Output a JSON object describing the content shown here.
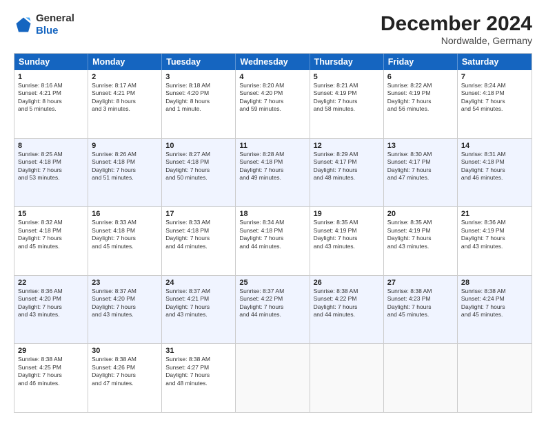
{
  "header": {
    "logo_line1": "General",
    "logo_line2": "Blue",
    "month_title": "December 2024",
    "location": "Nordwalde, Germany"
  },
  "weekdays": [
    "Sunday",
    "Monday",
    "Tuesday",
    "Wednesday",
    "Thursday",
    "Friday",
    "Saturday"
  ],
  "rows": [
    [
      {
        "day": "1",
        "lines": [
          "Sunrise: 8:16 AM",
          "Sunset: 4:21 PM",
          "Daylight: 8 hours",
          "and 5 minutes."
        ]
      },
      {
        "day": "2",
        "lines": [
          "Sunrise: 8:17 AM",
          "Sunset: 4:21 PM",
          "Daylight: 8 hours",
          "and 3 minutes."
        ]
      },
      {
        "day": "3",
        "lines": [
          "Sunrise: 8:18 AM",
          "Sunset: 4:20 PM",
          "Daylight: 8 hours",
          "and 1 minute."
        ]
      },
      {
        "day": "4",
        "lines": [
          "Sunrise: 8:20 AM",
          "Sunset: 4:20 PM",
          "Daylight: 7 hours",
          "and 59 minutes."
        ]
      },
      {
        "day": "5",
        "lines": [
          "Sunrise: 8:21 AM",
          "Sunset: 4:19 PM",
          "Daylight: 7 hours",
          "and 58 minutes."
        ]
      },
      {
        "day": "6",
        "lines": [
          "Sunrise: 8:22 AM",
          "Sunset: 4:19 PM",
          "Daylight: 7 hours",
          "and 56 minutes."
        ]
      },
      {
        "day": "7",
        "lines": [
          "Sunrise: 8:24 AM",
          "Sunset: 4:18 PM",
          "Daylight: 7 hours",
          "and 54 minutes."
        ]
      }
    ],
    [
      {
        "day": "8",
        "lines": [
          "Sunrise: 8:25 AM",
          "Sunset: 4:18 PM",
          "Daylight: 7 hours",
          "and 53 minutes."
        ]
      },
      {
        "day": "9",
        "lines": [
          "Sunrise: 8:26 AM",
          "Sunset: 4:18 PM",
          "Daylight: 7 hours",
          "and 51 minutes."
        ]
      },
      {
        "day": "10",
        "lines": [
          "Sunrise: 8:27 AM",
          "Sunset: 4:18 PM",
          "Daylight: 7 hours",
          "and 50 minutes."
        ]
      },
      {
        "day": "11",
        "lines": [
          "Sunrise: 8:28 AM",
          "Sunset: 4:18 PM",
          "Daylight: 7 hours",
          "and 49 minutes."
        ]
      },
      {
        "day": "12",
        "lines": [
          "Sunrise: 8:29 AM",
          "Sunset: 4:17 PM",
          "Daylight: 7 hours",
          "and 48 minutes."
        ]
      },
      {
        "day": "13",
        "lines": [
          "Sunrise: 8:30 AM",
          "Sunset: 4:17 PM",
          "Daylight: 7 hours",
          "and 47 minutes."
        ]
      },
      {
        "day": "14",
        "lines": [
          "Sunrise: 8:31 AM",
          "Sunset: 4:18 PM",
          "Daylight: 7 hours",
          "and 46 minutes."
        ]
      }
    ],
    [
      {
        "day": "15",
        "lines": [
          "Sunrise: 8:32 AM",
          "Sunset: 4:18 PM",
          "Daylight: 7 hours",
          "and 45 minutes."
        ]
      },
      {
        "day": "16",
        "lines": [
          "Sunrise: 8:33 AM",
          "Sunset: 4:18 PM",
          "Daylight: 7 hours",
          "and 45 minutes."
        ]
      },
      {
        "day": "17",
        "lines": [
          "Sunrise: 8:33 AM",
          "Sunset: 4:18 PM",
          "Daylight: 7 hours",
          "and 44 minutes."
        ]
      },
      {
        "day": "18",
        "lines": [
          "Sunrise: 8:34 AM",
          "Sunset: 4:18 PM",
          "Daylight: 7 hours",
          "and 44 minutes."
        ]
      },
      {
        "day": "19",
        "lines": [
          "Sunrise: 8:35 AM",
          "Sunset: 4:19 PM",
          "Daylight: 7 hours",
          "and 43 minutes."
        ]
      },
      {
        "day": "20",
        "lines": [
          "Sunrise: 8:35 AM",
          "Sunset: 4:19 PM",
          "Daylight: 7 hours",
          "and 43 minutes."
        ]
      },
      {
        "day": "21",
        "lines": [
          "Sunrise: 8:36 AM",
          "Sunset: 4:19 PM",
          "Daylight: 7 hours",
          "and 43 minutes."
        ]
      }
    ],
    [
      {
        "day": "22",
        "lines": [
          "Sunrise: 8:36 AM",
          "Sunset: 4:20 PM",
          "Daylight: 7 hours",
          "and 43 minutes."
        ]
      },
      {
        "day": "23",
        "lines": [
          "Sunrise: 8:37 AM",
          "Sunset: 4:20 PM",
          "Daylight: 7 hours",
          "and 43 minutes."
        ]
      },
      {
        "day": "24",
        "lines": [
          "Sunrise: 8:37 AM",
          "Sunset: 4:21 PM",
          "Daylight: 7 hours",
          "and 43 minutes."
        ]
      },
      {
        "day": "25",
        "lines": [
          "Sunrise: 8:37 AM",
          "Sunset: 4:22 PM",
          "Daylight: 7 hours",
          "and 44 minutes."
        ]
      },
      {
        "day": "26",
        "lines": [
          "Sunrise: 8:38 AM",
          "Sunset: 4:22 PM",
          "Daylight: 7 hours",
          "and 44 minutes."
        ]
      },
      {
        "day": "27",
        "lines": [
          "Sunrise: 8:38 AM",
          "Sunset: 4:23 PM",
          "Daylight: 7 hours",
          "and 45 minutes."
        ]
      },
      {
        "day": "28",
        "lines": [
          "Sunrise: 8:38 AM",
          "Sunset: 4:24 PM",
          "Daylight: 7 hours",
          "and 45 minutes."
        ]
      }
    ],
    [
      {
        "day": "29",
        "lines": [
          "Sunrise: 8:38 AM",
          "Sunset: 4:25 PM",
          "Daylight: 7 hours",
          "and 46 minutes."
        ]
      },
      {
        "day": "30",
        "lines": [
          "Sunrise: 8:38 AM",
          "Sunset: 4:26 PM",
          "Daylight: 7 hours",
          "and 47 minutes."
        ]
      },
      {
        "day": "31",
        "lines": [
          "Sunrise: 8:38 AM",
          "Sunset: 4:27 PM",
          "Daylight: 7 hours",
          "and 48 minutes."
        ]
      },
      {
        "day": "",
        "lines": []
      },
      {
        "day": "",
        "lines": []
      },
      {
        "day": "",
        "lines": []
      },
      {
        "day": "",
        "lines": []
      }
    ]
  ]
}
